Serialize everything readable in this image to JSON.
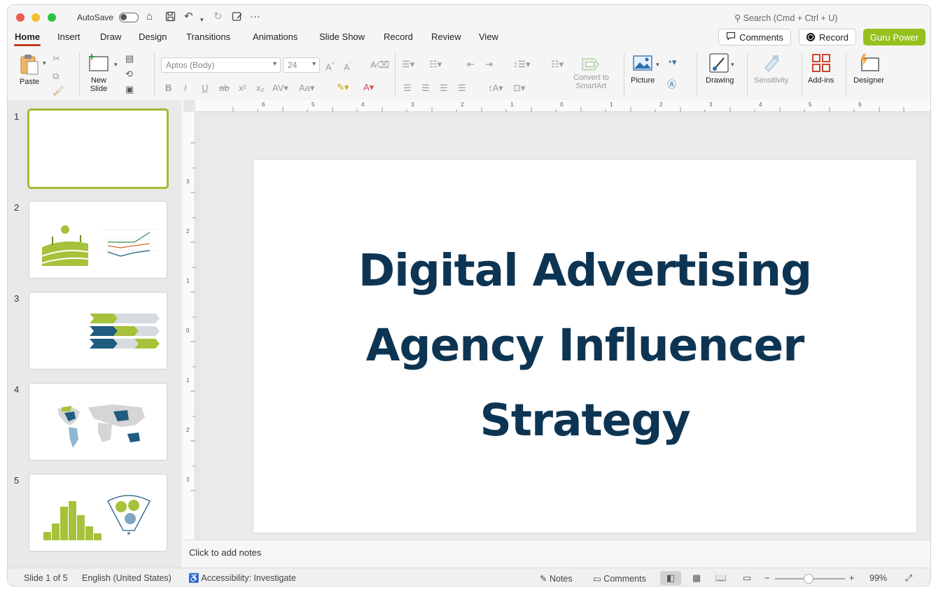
{
  "titlebar": {
    "autosave_label": "AutoSave",
    "search_placeholder": "Search (Cmd + Ctrl + U)"
  },
  "tabs": [
    "Home",
    "Insert",
    "Draw",
    "Design",
    "Transitions",
    "Animations",
    "Slide Show",
    "Record",
    "Review",
    "View"
  ],
  "actions": {
    "comments": "Comments",
    "record": "Record",
    "guru": "Guru Power"
  },
  "ribbon": {
    "paste": "Paste",
    "new_slide": "New\nSlide",
    "font_name": "Aptos (Body)",
    "font_size": "24",
    "convert": "Convert to\nSmartArt",
    "picture": "Picture",
    "drawing": "Drawing",
    "sensitivity": "Sensitivity",
    "addins": "Add-ins",
    "designer": "Designer"
  },
  "thumbnails": [
    {
      "number": "1"
    },
    {
      "number": "2"
    },
    {
      "number": "3"
    },
    {
      "number": "4"
    },
    {
      "number": "5"
    }
  ],
  "slide": {
    "title_line1": "Digital Advertising",
    "title_line2": "Agency Influencer",
    "title_line3": "Strategy"
  },
  "notes_placeholder": "Click to add notes",
  "status": {
    "slide_count": "Slide 1 of 5",
    "language": "English (United States)",
    "accessibility": "Accessibility: Investigate",
    "notes": "Notes",
    "comments": "Comments",
    "zoom": "99%"
  },
  "colors": {
    "accent_red": "#c43e1c",
    "brand_green": "#95c11f",
    "title_navy": "#0d3553",
    "thumb_teal": "#1f5c80"
  },
  "ruler": {
    "h_ticks": [
      "6",
      "5",
      "4",
      "3",
      "2",
      "1",
      "0",
      "1",
      "2",
      "3",
      "4",
      "5",
      "6"
    ],
    "v_ticks": [
      "3",
      "2",
      "1",
      "0",
      "1",
      "2",
      "3"
    ]
  }
}
